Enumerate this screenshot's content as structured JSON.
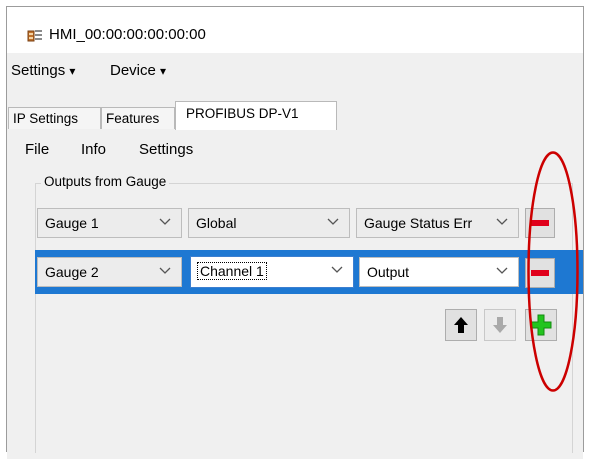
{
  "window": {
    "title": "HMI_00:00:00:00:00:00",
    "icon": "app-config-icon"
  },
  "menubar": [
    {
      "label": "Settings",
      "arrow": "▾"
    },
    {
      "label": "Device",
      "arrow": "▾"
    }
  ],
  "tabs": [
    {
      "label": "IP Settings",
      "active": false
    },
    {
      "label": "Features",
      "active": false
    },
    {
      "label": "PROFIBUS DP-V1",
      "active": true
    }
  ],
  "inner_menu": [
    "File",
    "Info",
    "Settings"
  ],
  "outputs_group": {
    "label": "Outputs from Gauge",
    "rows": [
      {
        "gauge": "Gauge 1",
        "scope": "Global",
        "signal": "Gauge Status Err",
        "selected": false,
        "action": "remove"
      },
      {
        "gauge": "Gauge 2",
        "scope": "Channel 1",
        "signal": "Output",
        "selected": true,
        "action": "remove"
      }
    ],
    "controls": {
      "move_up_icon": "arrow-up-icon",
      "move_down_icon": "arrow-down-icon",
      "add_icon": "plus-icon"
    }
  },
  "colors": {
    "selection": "#1e78d2",
    "remove": "#e0001b",
    "add": "#22c41e",
    "annotation": "#cc0000",
    "panel": "#f0f0f0"
  }
}
